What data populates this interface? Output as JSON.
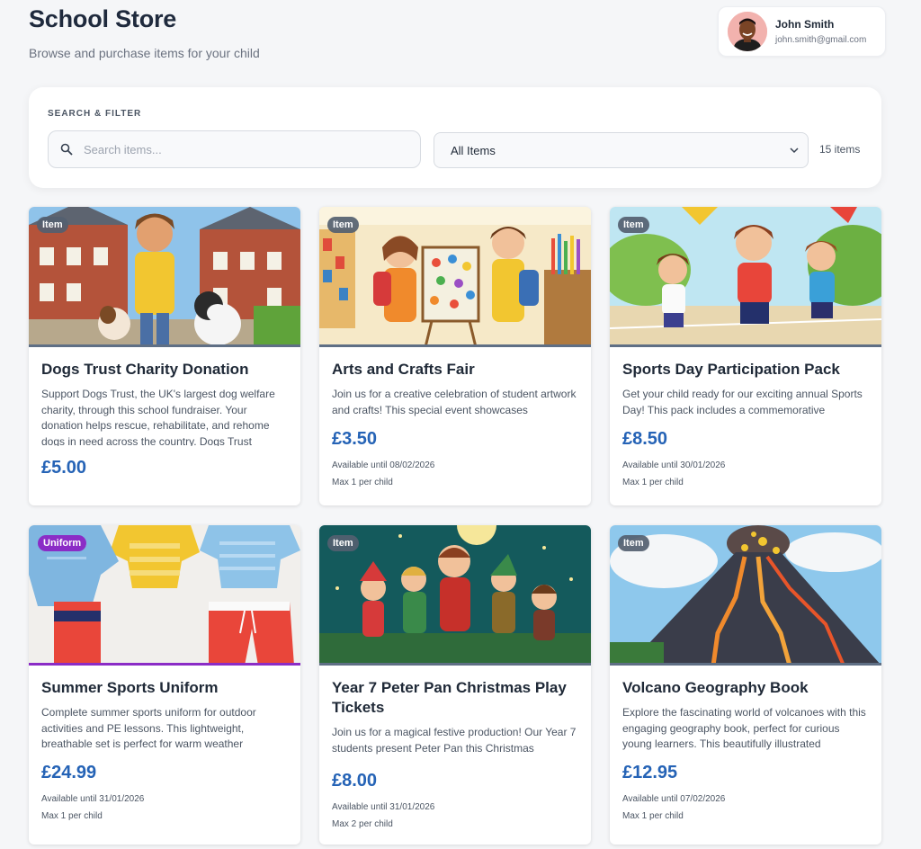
{
  "header": {
    "title": "School Store",
    "subtitle": "Browse and purchase items for your child"
  },
  "user": {
    "name": "John Smith",
    "email": "john.smith@gmail.com",
    "avatar_icon": "user-avatar"
  },
  "filter": {
    "heading": "SEARCH & FILTER",
    "search_placeholder": "Search items...",
    "search_value": "",
    "category_selected": "All Items",
    "item_count": "15 items"
  },
  "items": [
    {
      "tag": "Item",
      "title": "Dogs Trust Charity Donation",
      "description": "Support Dogs Trust, the UK's largest dog welfare charity, through this school fundraiser. Your donation helps rescue, rehabilitate, and rehome dogs in need across the country. Dogs Trust",
      "price": "£5.00",
      "available": "",
      "max": ""
    },
    {
      "tag": "Item",
      "title": "Arts and Crafts Fair",
      "description": "Join us for a creative celebration of student artwork and crafts! This special event showcases",
      "price": "£3.50",
      "available": "Available until 08/02/2026",
      "max": "Max 1 per child"
    },
    {
      "tag": "Item",
      "title": "Sports Day Participation Pack",
      "description": "Get your child ready for our exciting annual Sports Day! This pack includes a commemorative",
      "price": "£8.50",
      "available": "Available until 30/01/2026",
      "max": "Max 1 per child"
    },
    {
      "tag": "Uniform",
      "title": "Summer Sports Uniform",
      "description": "Complete summer sports uniform for outdoor activities and PE lessons. This lightweight, breathable set is perfect for warm weather",
      "price": "£24.99",
      "available": "Available until 31/01/2026",
      "max": "Max 1 per child"
    },
    {
      "tag": "Item",
      "title": "Year 7 Peter Pan Christmas Play Tickets",
      "description": "Join us for a magical festive production! Our Year 7 students present Peter Pan this Christmas",
      "price": "£8.00",
      "available": "Available until 31/01/2026",
      "max": "Max 2 per child"
    },
    {
      "tag": "Item",
      "title": "Volcano Geography Book",
      "description": "Explore the fascinating world of volcanoes with this engaging geography book, perfect for curious young learners. This beautifully illustrated",
      "price": "£12.95",
      "available": "Available until 07/02/2026",
      "max": "Max 1 per child"
    }
  ],
  "colors": {
    "accent_price": "#2563b6",
    "uniform_tag": "#8b2cc6",
    "item_tag": "#546070"
  }
}
